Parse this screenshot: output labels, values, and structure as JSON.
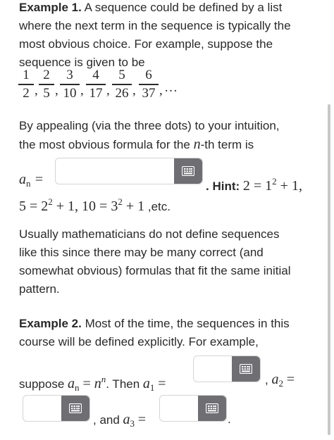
{
  "example1": {
    "heading": "Example 1.",
    "intro_lines": [
      "A sequence could be defined by a list",
      "where the next term in the sequence is typically the",
      "most obvious choice. For example, suppose the",
      "sequence is given to be"
    ],
    "fractions": [
      {
        "num": "1",
        "den": "2"
      },
      {
        "num": "2",
        "den": "5"
      },
      {
        "num": "3",
        "den": "10"
      },
      {
        "num": "4",
        "den": "17"
      },
      {
        "num": "5",
        "den": "26"
      },
      {
        "num": "6",
        "den": "37"
      }
    ],
    "ellipsis": "…",
    "appeal_lines": [
      "By appealing (via the three dots) to your intuition,",
      "the most obvious formula for the"
    ],
    "nth_term": "n",
    "nth_suffix": "-th term is",
    "an_label": "a",
    "an_sub": "n",
    "equals": "=",
    "hint_prefix": ". Hint:",
    "hint_math": "2 = 1",
    "hint_sup": "2",
    "hint_end": " + 1,",
    "hint_line2_a": "5 = 2",
    "hint_line2_b": " + 1, 10 = 3",
    "hint_line2_c": " + 1",
    "hint_line2_end": " ,etc.",
    "closing_lines": [
      "Usually mathematicians do not define sequences",
      "like this since there may be many correct (and",
      "somewhat obvious) formulas that fit the same initial",
      "pattern."
    ]
  },
  "example2": {
    "heading": "Example 2.",
    "lines": [
      "Most of the time, the sequences in this",
      "course will be defined explicitly. For example,"
    ],
    "suppose": "suppose",
    "def_lhs": "a",
    "def_sub": "n",
    "def_eq": " = ",
    "def_rhs": "n",
    "def_sup": "n",
    "then": ". Then",
    "a1": "a",
    "a1_sub": "1",
    "a2_prefix": ",",
    "a2": "a",
    "a2_sub": "2",
    "a3_prefix": ", and",
    "a3": "a",
    "a3_sub": "3",
    "period": "."
  },
  "answer_icon": "keyboard-grid-icon",
  "colors": {
    "keyboard_button": "#6e6e73",
    "text": "#2a2a2a",
    "border": "#d5d5d5"
  }
}
